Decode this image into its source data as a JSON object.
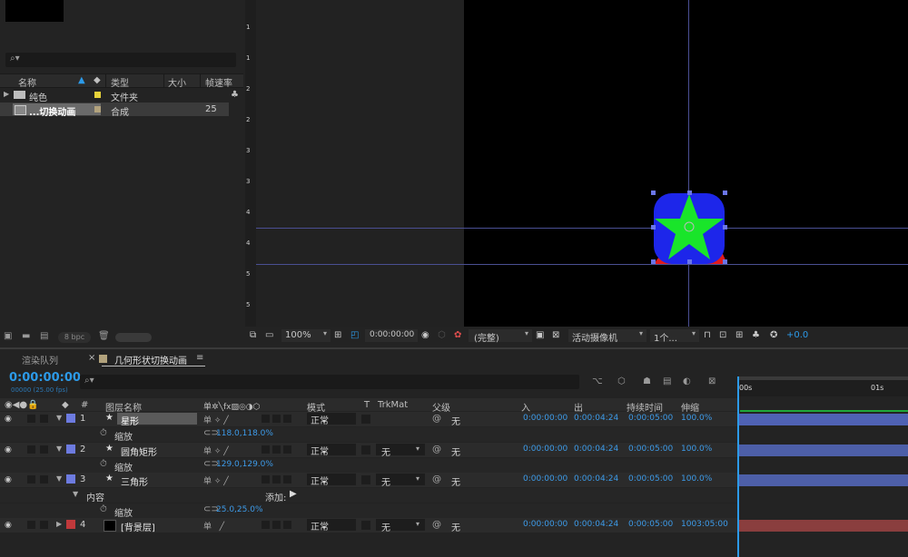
{
  "project": {
    "search_icon": "⌕▾",
    "headers": {
      "name": "名称",
      "type": "类型",
      "size": "大小",
      "fps": "帧速率"
    },
    "items": [
      {
        "name": "纯色",
        "type": "文件夹",
        "fps": "",
        "swatch": "#e6d23a",
        "icon": "folder-icon"
      },
      {
        "name": "...切换动画",
        "type": "合成",
        "fps": "25",
        "swatch": "#b2a27c",
        "icon": "composition-icon"
      }
    ],
    "bpc": "8 bpc"
  },
  "viewer": {
    "ruler_labels": [
      "1",
      "1",
      "2",
      "2",
      "3",
      "3",
      "4",
      "4",
      "5",
      "5"
    ],
    "zoom": "100%",
    "timecode": "0:00:00:00",
    "resolution": "(完整)",
    "camera": "活动摄像机",
    "views": "1个...",
    "exposure": "+0.0"
  },
  "timeline": {
    "tab_render": "渲染队列",
    "tab_comp": "几何形状切换动画",
    "timecode": "0:00:00:00",
    "fps_note": "00000 (25.00 fps)",
    "ruler": {
      "start": "00s",
      "mark": "01s"
    },
    "headers": {
      "num": "#",
      "layer_name": "图层名称",
      "mode": "模式",
      "t": "T",
      "trkmat": "TrkMat",
      "parent": "父级",
      "in": "入",
      "out": "出",
      "duration": "持续时间",
      "stretch": "伸缩"
    },
    "add_label": "添加:",
    "layers": [
      {
        "num": "1",
        "name": "星形",
        "label_color": "#6d7be0",
        "mode": "正常",
        "trkmat": "",
        "parent": "无",
        "in": "0:00:00:00",
        "out": "0:00:04:24",
        "duration": "0:00:05:00",
        "stretch": "100.0%",
        "track_color": "#4f62b4",
        "prop": {
          "name": "缩放",
          "value": "118.0,118.0%"
        }
      },
      {
        "num": "2",
        "name": "圆角矩形",
        "label_color": "#6d7be0",
        "mode": "正常",
        "trkmat": "无",
        "parent": "无",
        "in": "0:00:00:00",
        "out": "0:00:04:24",
        "duration": "0:00:05:00",
        "stretch": "100.0%",
        "track_color": "#4d5fa8",
        "prop": {
          "name": "缩放",
          "value": "129.0,129.0%"
        }
      },
      {
        "num": "3",
        "name": "三角形",
        "label_color": "#6d7be0",
        "mode": "正常",
        "trkmat": "无",
        "parent": "无",
        "in": "0:00:00:00",
        "out": "0:00:04:24",
        "duration": "0:00:05:00",
        "stretch": "100.0%",
        "track_color": "#4d5fa8",
        "group": "内容",
        "prop": {
          "name": "缩放",
          "value": "25.0,25.0%"
        }
      },
      {
        "num": "4",
        "name": "[背景层]",
        "label_color": "#c0393b",
        "mode": "正常",
        "trkmat": "无",
        "parent": "无",
        "in": "0:00:00:00",
        "out": "0:00:04:24",
        "duration": "0:00:05:00",
        "stretch": "1003:05:00",
        "track_color": "#8a3e3e"
      }
    ]
  },
  "colors": {
    "accent": "#2c9ae8",
    "star": "#19e52a",
    "rounded_rect": "#1d26ea",
    "triangle": "#e01b1b"
  }
}
